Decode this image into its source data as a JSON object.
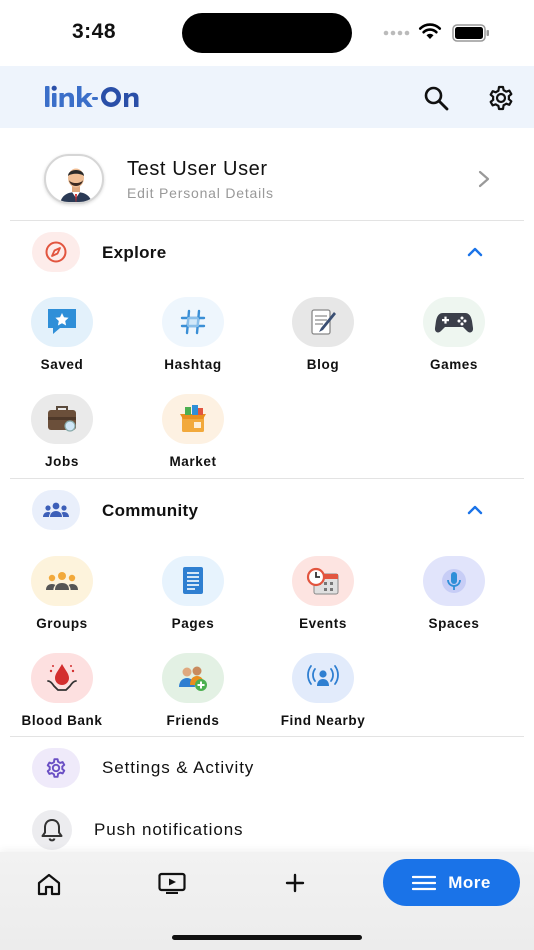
{
  "status_bar": {
    "time": "3:48"
  },
  "header": {
    "logo_text": "linkOn"
  },
  "profile": {
    "name": "Test User User",
    "subtitle": "Edit Personal Details"
  },
  "explore": {
    "title": "Explore",
    "items": [
      {
        "label": "Saved",
        "icon": "saved-icon"
      },
      {
        "label": "Hashtag",
        "icon": "hashtag-icon"
      },
      {
        "label": "Blog",
        "icon": "blog-icon"
      },
      {
        "label": "Games",
        "icon": "games-icon"
      },
      {
        "label": "Jobs",
        "icon": "jobs-icon"
      },
      {
        "label": "Market",
        "icon": "market-icon"
      }
    ]
  },
  "community": {
    "title": "Community",
    "items": [
      {
        "label": "Groups",
        "icon": "groups-icon"
      },
      {
        "label": "Pages",
        "icon": "pages-icon"
      },
      {
        "label": "Events",
        "icon": "events-icon"
      },
      {
        "label": "Spaces",
        "icon": "spaces-icon"
      },
      {
        "label": "Blood Bank",
        "icon": "blood-bank-icon"
      },
      {
        "label": "Friends",
        "icon": "friends-icon"
      },
      {
        "label": "Find Nearby",
        "icon": "find-nearby-icon"
      }
    ]
  },
  "settings_activity": {
    "label": "Settings & Activity"
  },
  "push_notifications": {
    "label": "Push notifications"
  },
  "bottom_nav": {
    "more_label": "More"
  },
  "colors": {
    "accent": "#1a73e8",
    "header_bg": "#eef4fc",
    "logo_blue": "#3b6fc9"
  }
}
